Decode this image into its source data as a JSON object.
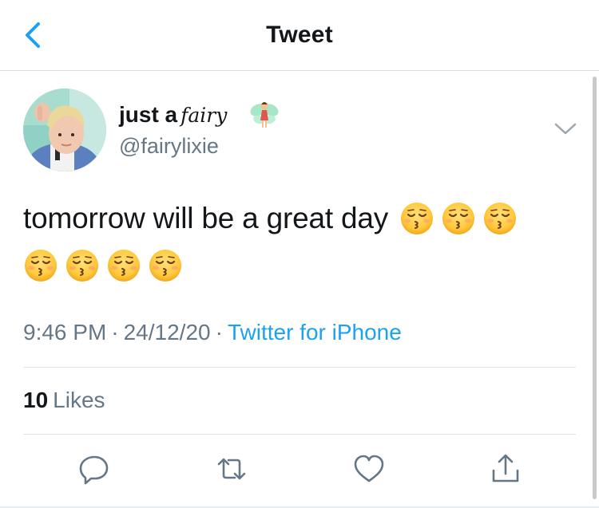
{
  "header": {
    "title": "Tweet",
    "back_icon": "chevron-left-icon"
  },
  "author": {
    "display_name_plain": "just a",
    "display_name_styled": "fairy",
    "display_name_emoji": "fairy-emoji-icon",
    "handle": "@fairylixie"
  },
  "tweet": {
    "text": "tomorrow will be a great day",
    "emoji_name": "kissing-face-with-closed-eyes-emoji",
    "emojis_line1_count": 3,
    "emojis_line2_count": 4
  },
  "meta": {
    "time": "9:46 PM",
    "separator": "·",
    "date": "24/12/20",
    "source": "Twitter for iPhone"
  },
  "stats": {
    "likes_count": "10",
    "likes_label": "Likes"
  },
  "actions": [
    "reply-icon",
    "retweet-icon",
    "like-icon",
    "share-icon"
  ],
  "colors": {
    "accent": "#1da1f2",
    "secondary_text": "#657786",
    "primary_text": "#14171a",
    "divider": "#dfe3e6",
    "icon_gray": "#657786"
  }
}
